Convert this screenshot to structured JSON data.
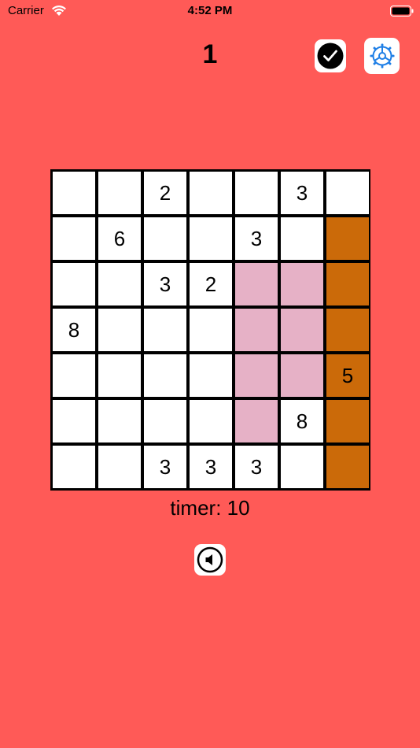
{
  "colors": {
    "background": "#ff5a57",
    "pink_region": "#e6b1c6",
    "orange_region": "#cb6a09"
  },
  "status_bar": {
    "carrier": "Carrier",
    "time": "4:52 PM"
  },
  "header": {
    "level": "1",
    "check_icon": "checkmark-circle-icon",
    "settings_icon": "gear-icon"
  },
  "grid": {
    "rows": [
      [
        "",
        "",
        "2",
        "",
        "",
        "3",
        ""
      ],
      [
        "",
        "6",
        "",
        "",
        "3",
        "",
        ""
      ],
      [
        "",
        "",
        "3",
        "2",
        "",
        "",
        ""
      ],
      [
        "8",
        "",
        "",
        "",
        "",
        "",
        ""
      ],
      [
        "",
        "",
        "",
        "",
        "",
        "",
        "5"
      ],
      [
        "",
        "",
        "",
        "",
        "",
        "8",
        ""
      ],
      [
        "",
        "",
        "3",
        "3",
        "3",
        "",
        ""
      ]
    ],
    "fills": [
      [
        "w",
        "w",
        "w",
        "w",
        "w",
        "w",
        "w"
      ],
      [
        "w",
        "w",
        "w",
        "w",
        "w",
        "w",
        "o"
      ],
      [
        "w",
        "w",
        "w",
        "w",
        "p",
        "p",
        "o"
      ],
      [
        "w",
        "w",
        "w",
        "w",
        "p",
        "p",
        "o"
      ],
      [
        "w",
        "w",
        "w",
        "w",
        "p",
        "p",
        "o"
      ],
      [
        "w",
        "w",
        "w",
        "w",
        "p",
        "w",
        "o"
      ],
      [
        "w",
        "w",
        "w",
        "w",
        "w",
        "w",
        "o"
      ]
    ]
  },
  "timer": {
    "text": "timer: 10"
  },
  "sound": {
    "icon": "speaker-icon"
  }
}
